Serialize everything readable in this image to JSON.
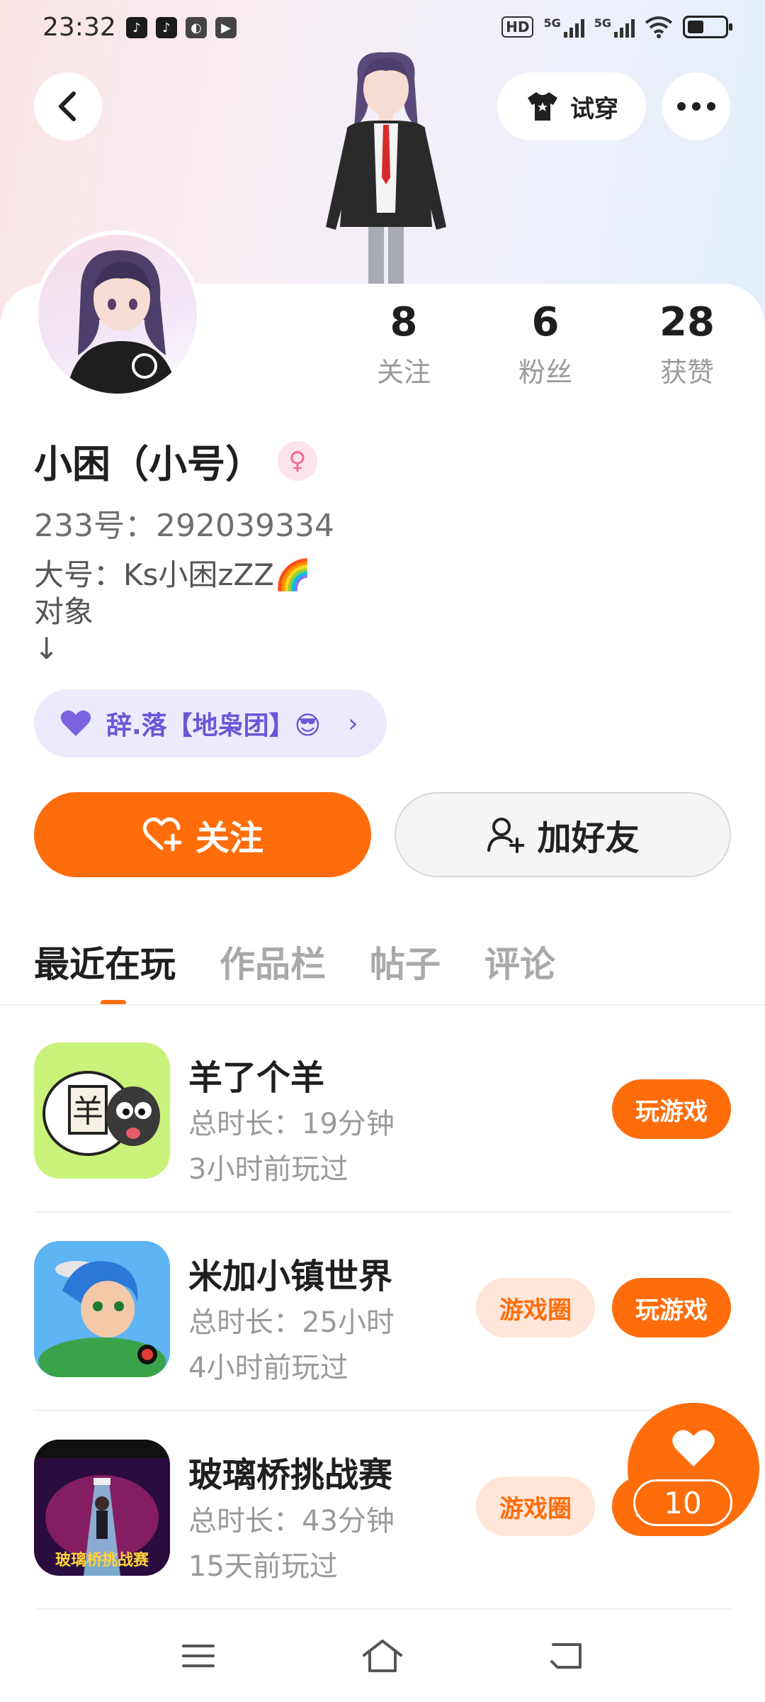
{
  "status_bar": {
    "time": "23:32",
    "network_chip": "HD",
    "signal_label_1": "5G",
    "signal_label_2": "5G"
  },
  "header": {
    "try_on_label": "试穿"
  },
  "profile": {
    "stats": [
      {
        "value": "8",
        "label": "关注"
      },
      {
        "value": "6",
        "label": "粉丝"
      },
      {
        "value": "28",
        "label": "获赞"
      }
    ],
    "name": "小困（小号）",
    "gender_symbol": "♀",
    "uid": "233号：292039334",
    "bio": "大号：Ks小困zZZ🌈\n对象\n↓",
    "guild": {
      "label": "辞.落【地枭团】😎",
      "chevron": "›"
    }
  },
  "actions": {
    "follow_label": "关注",
    "add_friend_label": "加好友"
  },
  "tabs": [
    "最近在玩",
    "作品栏",
    "帖子",
    "评论"
  ],
  "games": [
    {
      "title": "羊了个羊",
      "total_time": "总时长：19分钟",
      "last_played": "3小时前玩过",
      "play_label": "玩游戏",
      "circle_label": ""
    },
    {
      "title": "米加小镇世界",
      "total_time": "总时长：25小时",
      "last_played": "4小时前玩过",
      "play_label": "玩游戏",
      "circle_label": "游戏圈"
    },
    {
      "title": "玻璃桥挑战赛",
      "total_time": "总时长：43分钟",
      "last_played": "15天前玩过",
      "play_label": "玩游戏",
      "circle_label": "游戏圈"
    }
  ],
  "game3_icon_caption": "玻璃桥挑战赛",
  "like_fab": {
    "count": "10"
  },
  "colors": {
    "accent": "#ff6d0b",
    "guild_text": "#6b55d6",
    "guild_bg": "#ecebfd"
  }
}
